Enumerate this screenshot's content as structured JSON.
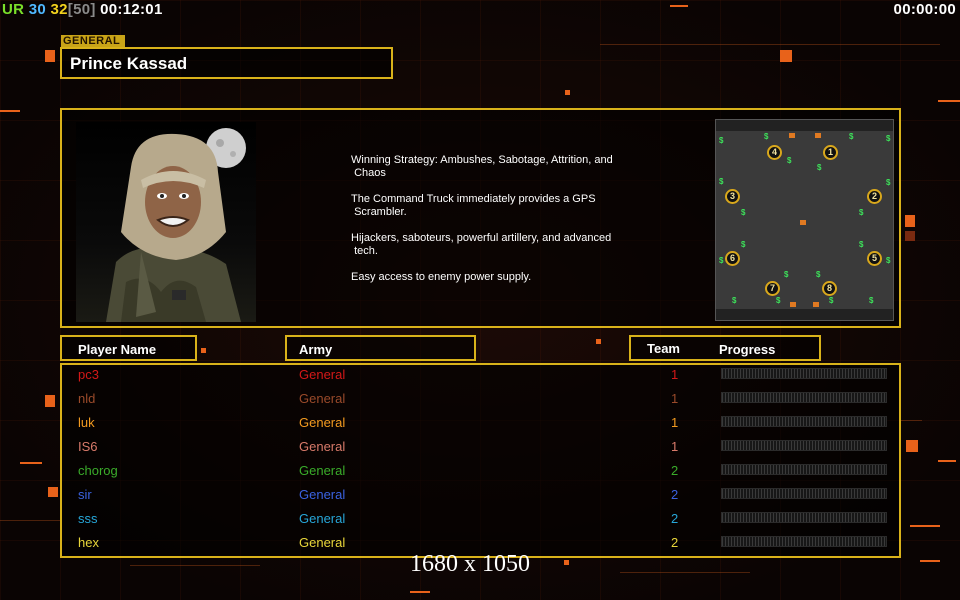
{
  "hud": {
    "ur_label": "UR",
    "stat_a": "30",
    "stat_b": "32",
    "stat_c": "[50]",
    "elapsed": "00:12:01",
    "timer": "00:00:00"
  },
  "general": {
    "tag": "GENERAL",
    "name": "Prince Kassad",
    "description": [
      "Winning Strategy: Ambushes, Sabotage, Attrition, and\n Chaos",
      "The Command Truck immediately provides a GPS\n Scrambler.",
      "Hijackers, saboteurs, powerful artillery, and advanced\n tech.",
      "Easy access to enemy power supply."
    ]
  },
  "minimap": {
    "spawns": [
      "4",
      "1",
      "3",
      "2",
      "6",
      "5",
      "7",
      "8"
    ],
    "cash_icon": "$"
  },
  "table": {
    "headers": {
      "player": "Player Name",
      "army": "Army",
      "team": "Team",
      "progress": "Progress"
    },
    "rows": [
      {
        "name": "pc3",
        "army": "General",
        "team": "1",
        "color": "#d41818",
        "progress": 0
      },
      {
        "name": "nld",
        "army": "General",
        "team": "1",
        "color": "#9a4a2a",
        "progress": 0
      },
      {
        "name": "luk",
        "army": "General",
        "team": "1",
        "color": "#f29a20",
        "progress": 0
      },
      {
        "name": "IS6",
        "army": "General",
        "team": "1",
        "color": "#d87a6a",
        "progress": 0
      },
      {
        "name": "chorog",
        "army": "General",
        "team": "2",
        "color": "#3aac2a",
        "progress": 0
      },
      {
        "name": "sir",
        "army": "General",
        "team": "2",
        "color": "#3a62e0",
        "progress": 0
      },
      {
        "name": "sss",
        "army": "General",
        "team": "2",
        "color": "#27a6d8",
        "progress": 0
      },
      {
        "name": "hex",
        "army": "General",
        "team": "2",
        "color": "#e8d63a",
        "progress": 0
      }
    ]
  },
  "footer": {
    "resolution": "1680 x 1050"
  },
  "colors": {
    "frame": "#d9b21a",
    "accent": "#e8621a"
  }
}
